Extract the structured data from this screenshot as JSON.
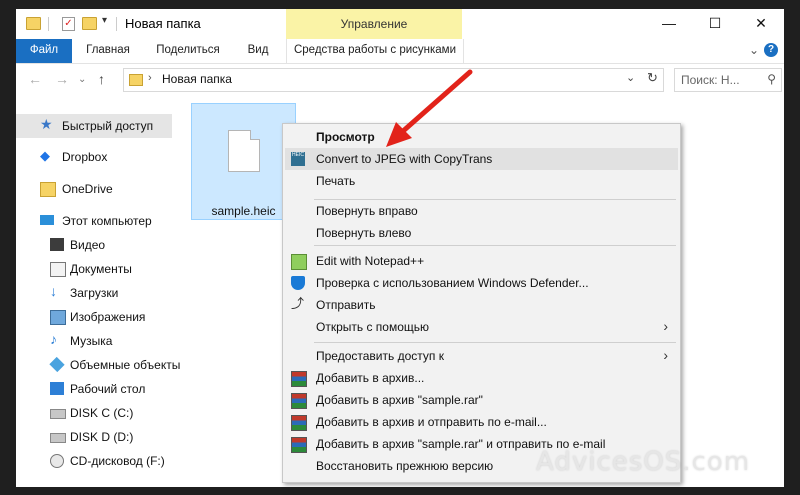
{
  "window": {
    "title": "Новая папка",
    "manage_tab": "Управление",
    "controls": {
      "minimize": "—",
      "maximize": "☐",
      "close": "✕"
    }
  },
  "ribbon": {
    "tabs": [
      "Файл",
      "Главная",
      "Поделиться",
      "Вид"
    ],
    "tools_tab": "Средства работы с рисунками",
    "help": "?"
  },
  "address": {
    "path": "Новая папка",
    "search_placeholder": "Поиск: Н..."
  },
  "sidebar": {
    "items": [
      {
        "label": "Быстрый доступ",
        "icon": "star-icon",
        "selected": true
      },
      {
        "label": "Dropbox",
        "icon": "dropbox-icon"
      },
      {
        "label": "OneDrive",
        "icon": "onedrive-icon"
      },
      {
        "label": "Этот компьютер",
        "icon": "computer-icon"
      },
      {
        "label": "Видео",
        "icon": "video-icon"
      },
      {
        "label": "Документы",
        "icon": "documents-icon"
      },
      {
        "label": "Загрузки",
        "icon": "downloads-icon"
      },
      {
        "label": "Изображения",
        "icon": "pictures-icon"
      },
      {
        "label": "Музыка",
        "icon": "music-icon"
      },
      {
        "label": "Объемные объекты",
        "icon": "3d-objects-icon"
      },
      {
        "label": "Рабочий стол",
        "icon": "desktop-icon"
      },
      {
        "label": "DISK C (C:)",
        "icon": "drive-icon"
      },
      {
        "label": "DISK D (D:)",
        "icon": "drive-icon"
      },
      {
        "label": "CD-дисковод (F:)",
        "icon": "cd-drive-icon"
      }
    ]
  },
  "files": [
    {
      "name": "sample.heic"
    }
  ],
  "context_menu": {
    "items": [
      {
        "label": "Просмотр",
        "bold": true
      },
      {
        "label": "Convert to JPEG with CopyTrans",
        "icon": "copytrans-icon",
        "highlighted": true
      },
      {
        "label": "Печать"
      },
      {
        "label": "Повернуть вправо"
      },
      {
        "label": "Повернуть влево"
      },
      {
        "label": "Edit with Notepad++",
        "icon": "notepadpp-icon"
      },
      {
        "label": "Проверка с использованием Windows Defender...",
        "icon": "defender-icon"
      },
      {
        "label": "Отправить",
        "icon": "share-icon"
      },
      {
        "label": "Открыть с помощью",
        "submenu": true
      },
      {
        "label": "Предоставить доступ к",
        "submenu": true
      },
      {
        "label": "Добавить в архив...",
        "icon": "winrar-icon"
      },
      {
        "label": "Добавить в архив \"sample.rar\"",
        "icon": "winrar-icon"
      },
      {
        "label": "Добавить в архив и отправить по e-mail...",
        "icon": "winrar-icon"
      },
      {
        "label": "Добавить в архив \"sample.rar\" и отправить по e-mail",
        "icon": "winrar-icon"
      },
      {
        "label": "Восстановить прежнюю версию"
      }
    ],
    "copytrans_icon_text": "HEIC"
  },
  "watermark": "AdvicesOS.com",
  "colors": {
    "accent": "#1a6fc2",
    "manage_tab": "#faf3a6",
    "selection": "#cce8ff",
    "annotation_arrow": "#e2231a"
  }
}
